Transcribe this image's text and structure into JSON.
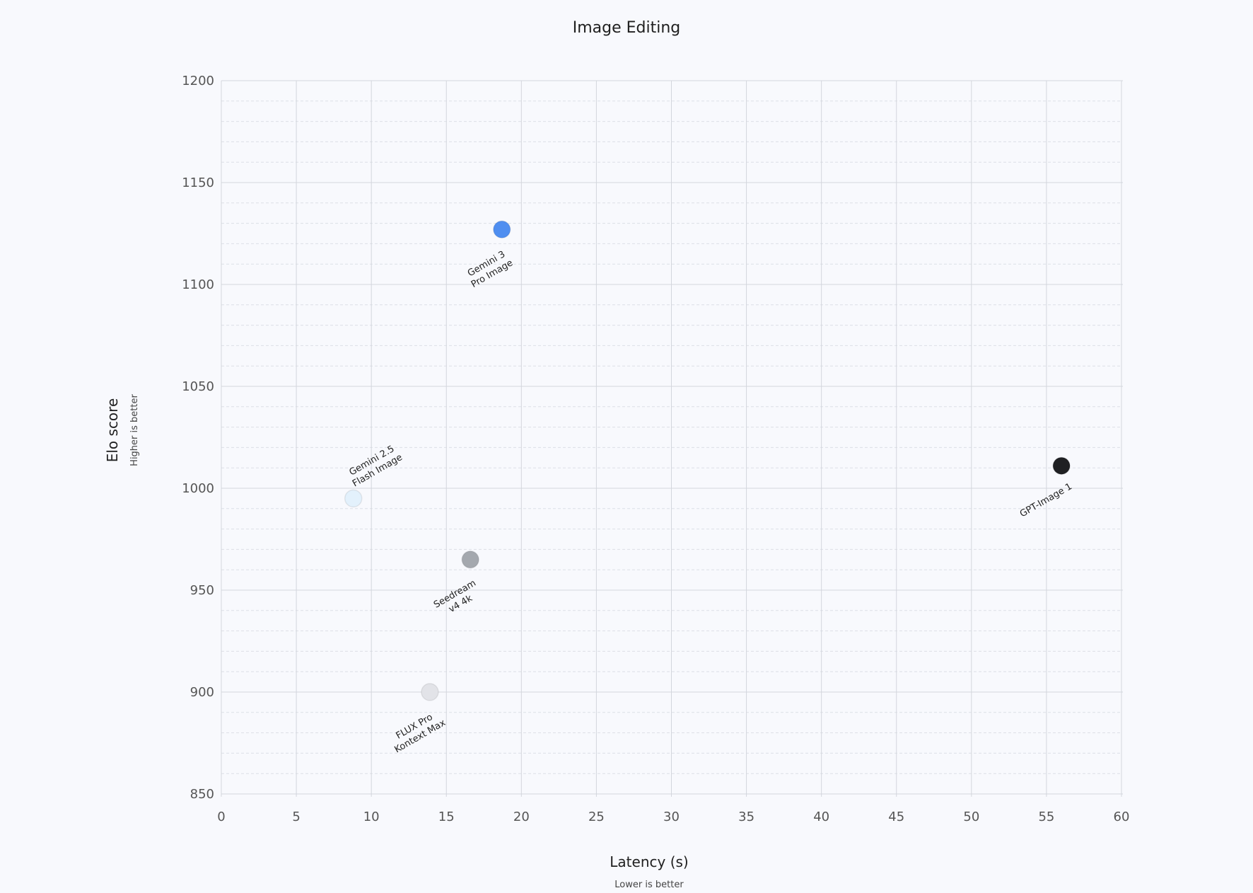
{
  "chart_data": {
    "type": "scatter",
    "title": "Image Editing",
    "xlabel": "Latency (s)",
    "xlabel_sub": "Lower is better",
    "ylabel": "Elo score",
    "ylabel_sub": "Higher is better",
    "xlim": [
      0,
      60
    ],
    "ylim": [
      850,
      1200
    ],
    "xticks": [
      0,
      5,
      10,
      15,
      20,
      25,
      30,
      35,
      40,
      45,
      50,
      55,
      60
    ],
    "yticks": [
      850,
      900,
      950,
      1000,
      1050,
      1100,
      1150,
      1200
    ],
    "grid": true,
    "points": [
      {
        "label_lines": [
          "Gemini 3",
          "Pro Image"
        ],
        "x": 18.7,
        "y": 1127,
        "color": "#4f8ef0",
        "label_pos": "below"
      },
      {
        "label_lines": [
          "Gemini 2.5",
          "Flash Image"
        ],
        "x": 8.8,
        "y": 995,
        "color": "#e3f1fc",
        "label_pos": "above"
      },
      {
        "label_lines": [
          "GPT-Image 1"
        ],
        "x": 56.0,
        "y": 1011,
        "color": "#1f2023",
        "label_pos": "below"
      },
      {
        "label_lines": [
          "Seedream",
          "v4 4k"
        ],
        "x": 16.6,
        "y": 965,
        "color": "#a4a8ae",
        "label_pos": "below"
      },
      {
        "label_lines": [
          "FLUX Pro",
          "Kontext Max"
        ],
        "x": 13.9,
        "y": 900,
        "color": "#e2e3e8",
        "label_pos": "below"
      }
    ]
  }
}
